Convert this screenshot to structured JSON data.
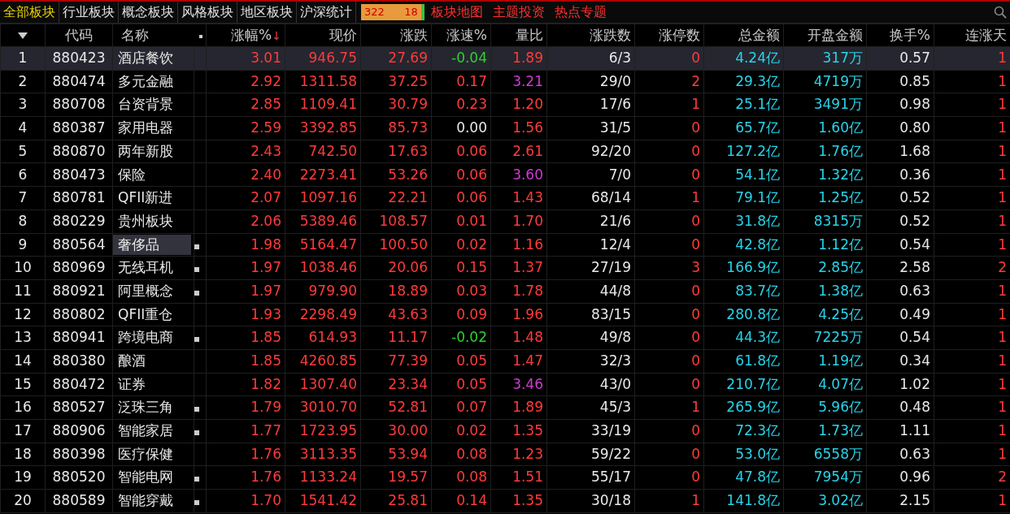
{
  "tabs": [
    {
      "label": "全部板块",
      "selected": true
    },
    {
      "label": "行业板块",
      "selected": false
    },
    {
      "label": "概念板块",
      "selected": false
    },
    {
      "label": "风格板块",
      "selected": false
    },
    {
      "label": "地区板块",
      "selected": false
    },
    {
      "label": "沪深统计",
      "selected": false
    }
  ],
  "breadth": {
    "up": "322",
    "down": "18",
    "level": 0.947
  },
  "links": [
    "板块地图",
    "主题投资",
    "热点专题"
  ],
  "columns": [
    "代码",
    "名称",
    "涨幅%",
    "现价",
    "涨跌",
    "涨速%",
    "量比",
    "涨跌数",
    "涨停数",
    "总金额",
    "开盘金额",
    "换手%",
    "连涨天"
  ],
  "sort_arrow": "↓",
  "rows": [
    {
      "no": "1",
      "code": "880423",
      "name": "酒店餐饮",
      "marked": false,
      "focused": false,
      "selected": true,
      "pct": "3.01",
      "price": "946.75",
      "chg": "27.69",
      "speed": "-0.04",
      "vr": "1.89",
      "ud": "6/3",
      "limit": "0",
      "amount": "4.24亿",
      "open": "317万",
      "turn": "0.57",
      "days": "1"
    },
    {
      "no": "2",
      "code": "880474",
      "name": "多元金融",
      "marked": false,
      "focused": false,
      "selected": false,
      "pct": "2.92",
      "price": "1311.58",
      "chg": "37.25",
      "speed": "0.17",
      "vr": "3.21",
      "ud": "29/0",
      "limit": "2",
      "amount": "29.3亿",
      "open": "4719万",
      "turn": "0.85",
      "days": "1"
    },
    {
      "no": "3",
      "code": "880708",
      "name": "台资背景",
      "marked": false,
      "focused": false,
      "selected": false,
      "pct": "2.85",
      "price": "1109.41",
      "chg": "30.79",
      "speed": "0.23",
      "vr": "1.20",
      "ud": "17/6",
      "limit": "1",
      "amount": "25.1亿",
      "open": "3491万",
      "turn": "0.98",
      "days": "1"
    },
    {
      "no": "4",
      "code": "880387",
      "name": "家用电器",
      "marked": false,
      "focused": false,
      "selected": false,
      "pct": "2.59",
      "price": "3392.85",
      "chg": "85.73",
      "speed": "0.00",
      "vr": "1.56",
      "ud": "31/5",
      "limit": "0",
      "amount": "65.7亿",
      "open": "1.60亿",
      "turn": "0.80",
      "days": "1"
    },
    {
      "no": "5",
      "code": "880870",
      "name": "两年新股",
      "marked": false,
      "focused": false,
      "selected": false,
      "pct": "2.43",
      "price": "742.50",
      "chg": "17.63",
      "speed": "0.06",
      "vr": "2.61",
      "ud": "92/20",
      "limit": "0",
      "amount": "127.2亿",
      "open": "1.76亿",
      "turn": "1.68",
      "days": "1"
    },
    {
      "no": "6",
      "code": "880473",
      "name": "保险",
      "marked": false,
      "focused": false,
      "selected": false,
      "pct": "2.40",
      "price": "2273.41",
      "chg": "53.26",
      "speed": "0.06",
      "vr": "3.60",
      "ud": "7/0",
      "limit": "0",
      "amount": "54.1亿",
      "open": "1.32亿",
      "turn": "0.36",
      "days": "1"
    },
    {
      "no": "7",
      "code": "880781",
      "name": "QFII新进",
      "marked": false,
      "focused": false,
      "selected": false,
      "pct": "2.07",
      "price": "1097.16",
      "chg": "22.21",
      "speed": "0.06",
      "vr": "1.43",
      "ud": "68/14",
      "limit": "1",
      "amount": "79.1亿",
      "open": "1.25亿",
      "turn": "0.52",
      "days": "1"
    },
    {
      "no": "8",
      "code": "880229",
      "name": "贵州板块",
      "marked": false,
      "focused": false,
      "selected": false,
      "pct": "2.06",
      "price": "5389.46",
      "chg": "108.57",
      "speed": "0.01",
      "vr": "1.70",
      "ud": "21/6",
      "limit": "0",
      "amount": "31.8亿",
      "open": "8315万",
      "turn": "0.52",
      "days": "1"
    },
    {
      "no": "9",
      "code": "880564",
      "name": "奢侈品",
      "marked": true,
      "focused": true,
      "selected": false,
      "pct": "1.98",
      "price": "5164.47",
      "chg": "100.50",
      "speed": "0.02",
      "vr": "1.16",
      "ud": "12/4",
      "limit": "0",
      "amount": "42.8亿",
      "open": "1.12亿",
      "turn": "0.54",
      "days": "1"
    },
    {
      "no": "10",
      "code": "880969",
      "name": "无线耳机",
      "marked": true,
      "focused": false,
      "selected": false,
      "pct": "1.97",
      "price": "1038.46",
      "chg": "20.06",
      "speed": "0.15",
      "vr": "1.37",
      "ud": "27/19",
      "limit": "3",
      "amount": "166.9亿",
      "open": "2.85亿",
      "turn": "2.58",
      "days": "2"
    },
    {
      "no": "11",
      "code": "880921",
      "name": "阿里概念",
      "marked": true,
      "focused": false,
      "selected": false,
      "pct": "1.97",
      "price": "979.90",
      "chg": "18.89",
      "speed": "0.03",
      "vr": "1.78",
      "ud": "44/8",
      "limit": "0",
      "amount": "83.7亿",
      "open": "1.38亿",
      "turn": "0.63",
      "days": "1"
    },
    {
      "no": "12",
      "code": "880802",
      "name": "QFII重仓",
      "marked": false,
      "focused": false,
      "selected": false,
      "pct": "1.93",
      "price": "2298.49",
      "chg": "43.63",
      "speed": "0.09",
      "vr": "1.96",
      "ud": "83/15",
      "limit": "0",
      "amount": "280.8亿",
      "open": "4.25亿",
      "turn": "0.49",
      "days": "1"
    },
    {
      "no": "13",
      "code": "880941",
      "name": "跨境电商",
      "marked": true,
      "focused": false,
      "selected": false,
      "pct": "1.85",
      "price": "614.93",
      "chg": "11.17",
      "speed": "-0.02",
      "vr": "1.48",
      "ud": "49/8",
      "limit": "0",
      "amount": "44.3亿",
      "open": "7225万",
      "turn": "0.54",
      "days": "1"
    },
    {
      "no": "14",
      "code": "880380",
      "name": "酿酒",
      "marked": false,
      "focused": false,
      "selected": false,
      "pct": "1.85",
      "price": "4260.85",
      "chg": "77.39",
      "speed": "0.05",
      "vr": "1.47",
      "ud": "32/3",
      "limit": "0",
      "amount": "61.8亿",
      "open": "1.19亿",
      "turn": "0.34",
      "days": "1"
    },
    {
      "no": "15",
      "code": "880472",
      "name": "证券",
      "marked": false,
      "focused": false,
      "selected": false,
      "pct": "1.82",
      "price": "1307.40",
      "chg": "23.34",
      "speed": "0.05",
      "vr": "3.46",
      "ud": "43/0",
      "limit": "0",
      "amount": "210.7亿",
      "open": "4.07亿",
      "turn": "1.02",
      "days": "1"
    },
    {
      "no": "16",
      "code": "880527",
      "name": "泛珠三角",
      "marked": true,
      "focused": false,
      "selected": false,
      "pct": "1.79",
      "price": "3010.70",
      "chg": "52.81",
      "speed": "0.07",
      "vr": "1.89",
      "ud": "45/3",
      "limit": "1",
      "amount": "265.9亿",
      "open": "5.96亿",
      "turn": "0.48",
      "days": "1"
    },
    {
      "no": "17",
      "code": "880906",
      "name": "智能家居",
      "marked": true,
      "focused": false,
      "selected": false,
      "pct": "1.77",
      "price": "1723.95",
      "chg": "30.00",
      "speed": "0.02",
      "vr": "1.35",
      "ud": "33/19",
      "limit": "0",
      "amount": "72.3亿",
      "open": "1.73亿",
      "turn": "1.11",
      "days": "1"
    },
    {
      "no": "18",
      "code": "880398",
      "name": "医疗保健",
      "marked": false,
      "focused": false,
      "selected": false,
      "pct": "1.76",
      "price": "3113.35",
      "chg": "53.94",
      "speed": "0.08",
      "vr": "1.23",
      "ud": "59/22",
      "limit": "0",
      "amount": "53.0亿",
      "open": "6558万",
      "turn": "0.63",
      "days": "1"
    },
    {
      "no": "19",
      "code": "880520",
      "name": "智能电网",
      "marked": true,
      "focused": false,
      "selected": false,
      "pct": "1.76",
      "price": "1133.24",
      "chg": "19.57",
      "speed": "0.08",
      "vr": "1.51",
      "ud": "55/17",
      "limit": "0",
      "amount": "47.8亿",
      "open": "7954万",
      "turn": "0.96",
      "days": "2"
    },
    {
      "no": "20",
      "code": "880589",
      "name": "智能穿戴",
      "marked": true,
      "focused": false,
      "selected": false,
      "pct": "1.70",
      "price": "1541.42",
      "chg": "25.81",
      "speed": "0.14",
      "vr": "1.35",
      "ud": "30/18",
      "limit": "1",
      "amount": "141.8亿",
      "open": "3.02亿",
      "turn": "2.15",
      "days": "1"
    }
  ]
}
